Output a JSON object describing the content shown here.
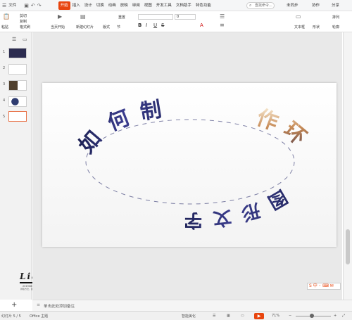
{
  "menubar": {
    "file": "文件",
    "tabs": [
      "开始",
      "插入",
      "设计",
      "切换",
      "动画",
      "放映",
      "审阅",
      "视图",
      "开发工具",
      "文档助手",
      "特色功能"
    ],
    "search_placeholder": "查找命令...",
    "sync": "未同步",
    "collab": "协作",
    "share": "分享"
  },
  "toolbar": {
    "paste": "粘贴",
    "cut": "剪切",
    "copy": "复制",
    "format": "格式刷",
    "current_start": "当页开始",
    "new_slide": "新建幻灯片",
    "layout": "版式",
    "section": "节",
    "reset": "重置",
    "font_size": "0",
    "textbox": "文本框",
    "shape": "形状",
    "arrange": "排列",
    "outline": "轮廓"
  },
  "thumbnails": [
    {
      "num": "1"
    },
    {
      "num": "2"
    },
    {
      "num": "3"
    },
    {
      "num": "4"
    },
    {
      "num": "5"
    }
  ],
  "slide": {
    "arc_top": "如何制",
    "arc_right": "作环",
    "arc_bottom": "图形文字"
  },
  "logo": {
    "text": "Lian",
    "sub1": "lian",
    "sub2": "20190808",
    "sub3": "排版方法，图形环绕"
  },
  "notes": {
    "placeholder": "单击此处添加备注",
    "add": "+"
  },
  "statusbar": {
    "slide_info": "幻灯片 5 / 5",
    "theme": "Office 主题",
    "smart": "智能美化",
    "zoom": "71%"
  }
}
